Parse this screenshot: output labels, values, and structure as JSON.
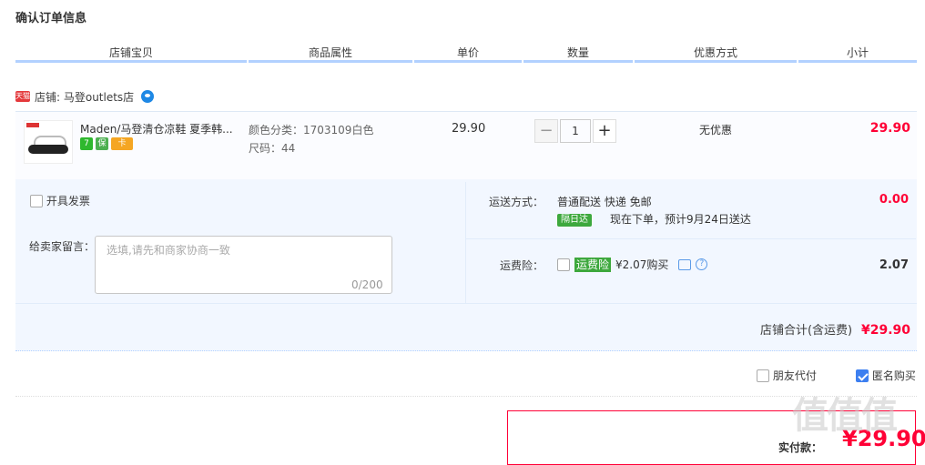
{
  "page": {
    "section_title": "确认订单信息"
  },
  "headers": [
    "店铺宝贝",
    "商品属性",
    "单价",
    "数量",
    "优惠方式",
    "小计"
  ],
  "shop": {
    "badge": "天猫",
    "label": "店铺: 马登outlets店"
  },
  "item": {
    "title": "Maden/马登清仓凉鞋 夏季韩...",
    "service_icons": [
      {
        "name": "seven-day-return-icon",
        "glyph": "7",
        "color": "#2eb82e"
      },
      {
        "name": "guarantee-icon",
        "glyph": "保",
        "color": "#4caf50"
      },
      {
        "name": "credit-card-icon",
        "glyph": "卡",
        "color": "#f5a623"
      }
    ],
    "color_attr": "颜色分类：1703109白色",
    "size_attr": "尺码：44",
    "price": "29.90",
    "qty_minus": "−",
    "quantity": "1",
    "qty_plus": "+",
    "promo": "无优惠",
    "subtotal": "29.90"
  },
  "invoice": {
    "label": "开具发票",
    "checked": false
  },
  "message": {
    "label": "给卖家留言：",
    "placeholder": "选填,请先和商家协商一致",
    "counter": "0/200"
  },
  "shipping": {
    "label": "运送方式：",
    "method": "普通配送 快递 免邮",
    "tag": "隔日达",
    "estimate": "现在下单，预计9月24日送达",
    "cost": "0.00"
  },
  "insurance": {
    "label": "运费险：",
    "tag": "运费险",
    "price_text": "¥2.07购买",
    "help": "?",
    "cost": "2.07"
  },
  "shop_total": {
    "label": "店铺合计(含运费)",
    "value": "¥29.90"
  },
  "options": {
    "friend_pay": {
      "label": "朋友代付",
      "checked": false
    },
    "anonymous": {
      "label": "匿名购买",
      "checked": true
    }
  },
  "payment": {
    "label": "实付款：",
    "value": "¥29.90"
  },
  "watermark": "值值值",
  "colors": {
    "accent_red": "#ff0036",
    "header_line": "#b2d1ff",
    "extra_bg": "#f2f7ff"
  }
}
